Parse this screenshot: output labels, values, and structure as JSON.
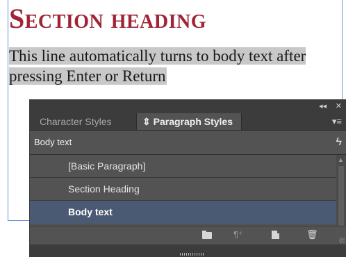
{
  "document": {
    "heading": "Section heading",
    "body_text": "This line automatically turns to body text after pressing Enter or Return"
  },
  "panel": {
    "title_controls": {
      "collapse": "◂◂",
      "close": "✕"
    },
    "tabs": [
      {
        "label": "Character Styles"
      },
      {
        "label": "⇕ Paragraph Styles"
      }
    ],
    "tab_menu_icon": "panel-menu-icon",
    "current_style": "Body text",
    "quick_apply_icon": "lightning-icon",
    "styles": [
      {
        "label": "[Basic Paragraph]"
      },
      {
        "label": "Section Heading"
      },
      {
        "label": "Body text"
      }
    ],
    "bottom_icons": [
      "folder-icon",
      "clear-overrides-icon",
      "new-style-icon",
      "trash-icon"
    ],
    "selection_color": "#4a5a72",
    "heading_color": "#a02336"
  }
}
